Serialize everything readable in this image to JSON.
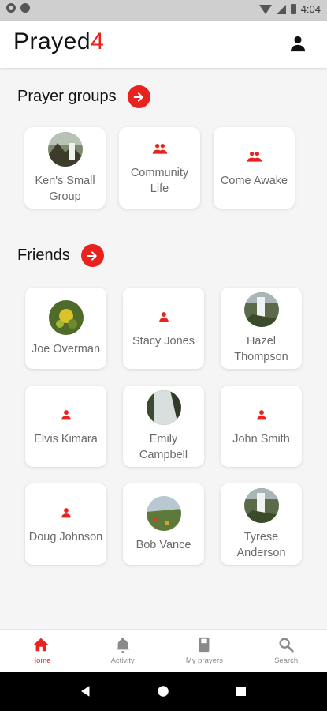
{
  "status_bar": {
    "time": "4:04"
  },
  "app": {
    "logo_main": "Prayed",
    "logo_accent": "4",
    "accent_color": "#e8231f"
  },
  "prayer_groups": {
    "title": "Prayer groups",
    "items": [
      {
        "label": "Ken's Small Group",
        "avatar": "landscape-photo"
      },
      {
        "label": "Community Life",
        "icon": "group-icon"
      },
      {
        "label": "Come Awake",
        "icon": "group-icon"
      }
    ]
  },
  "friends": {
    "title": "Friends",
    "items": [
      {
        "label": "Joe Overman",
        "avatar": "flower-photo"
      },
      {
        "label": "Stacy Jones",
        "icon": "person-icon"
      },
      {
        "label": "Hazel Thompson",
        "avatar": "waterfall-photo"
      },
      {
        "label": "Elvis Kimara",
        "icon": "person-icon"
      },
      {
        "label": "Emily Campbell",
        "avatar": "waterfall-photo"
      },
      {
        "label": "John Smith",
        "icon": "person-icon"
      },
      {
        "label": "Doug Johnson",
        "icon": "person-icon"
      },
      {
        "label": "Bob Vance",
        "avatar": "meadow-photo"
      },
      {
        "label": "Tyrese Anderson",
        "avatar": "waterfall-photo"
      }
    ]
  },
  "bottom_nav": [
    {
      "label": "Home",
      "icon": "home-icon",
      "active": true
    },
    {
      "label": "Activity",
      "icon": "bell-icon",
      "active": false
    },
    {
      "label": "My prayers",
      "icon": "book-icon",
      "active": false
    },
    {
      "label": "Search",
      "icon": "search-icon",
      "active": false
    }
  ]
}
